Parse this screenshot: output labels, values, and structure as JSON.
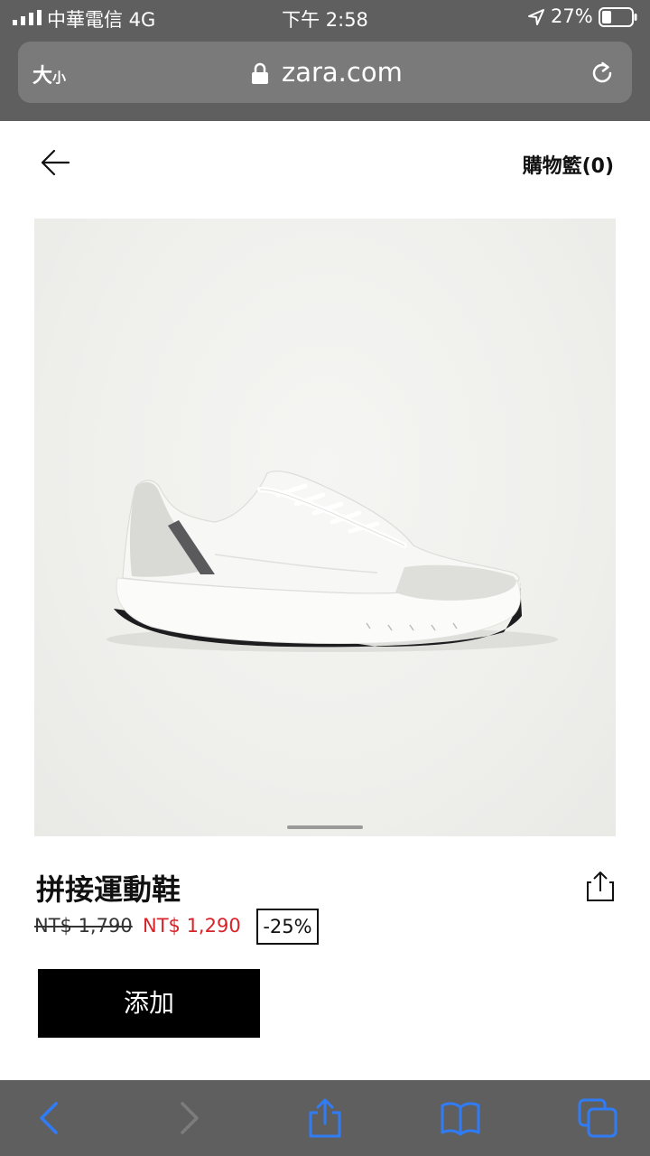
{
  "status_bar": {
    "carrier": "中華電信  4G",
    "time": "下午 2:58",
    "battery": "27%"
  },
  "url_bar": {
    "text_size_big": "大",
    "text_size_small": "小",
    "domain": "zara.com"
  },
  "header": {
    "cart_label": "購物籃(0)"
  },
  "product": {
    "name": "拼接運動鞋",
    "original_price": "NT$ 1,790",
    "sale_price": "NT$ 1,290",
    "discount": "-25%",
    "add_label": "添加"
  },
  "colors": {
    "sale": "#d8232a",
    "safari_blue": "#2f7cf6",
    "chrome_gray": "#5f5f5f"
  },
  "icons": {
    "back": "arrow-left-icon",
    "share": "share-icon",
    "toolbar": [
      "back-icon",
      "forward-icon",
      "share-icon",
      "bookmarks-icon",
      "tabs-icon"
    ]
  }
}
